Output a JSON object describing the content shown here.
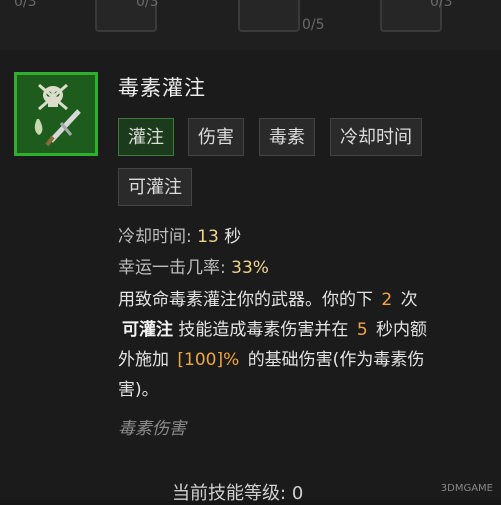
{
  "top_strip": {
    "counts": [
      "0/3",
      "0/3",
      "0/3",
      "0/5"
    ]
  },
  "skill": {
    "title": "毒素灌注",
    "icon": "poison-skull-dagger-icon",
    "tags": [
      "灌注",
      "伤害",
      "毒素",
      "冷却时间",
      "可灌注"
    ]
  },
  "stats": {
    "cooldown_label": "冷却时间:",
    "cooldown_value": "13",
    "cooldown_unit": "秒",
    "lucky_label": "幸运一击几率:",
    "lucky_value": "33%"
  },
  "description": {
    "l1_a": "用致命毒素灌注你的武器。你的下",
    "l1_num": "2",
    "l1_b": "次",
    "l2_key": "可灌注",
    "l2_a": "技能造成毒素伤害并在",
    "l2_num": "5",
    "l2_b": "秒内额",
    "l3_a": "外施加",
    "l3_num": "[100]%",
    "l3_b": "的基础伤害(作为毒素伤",
    "l4": "害)。"
  },
  "damage_type": "毒素伤害",
  "level": {
    "label": "当前技能等级:",
    "value": "0"
  },
  "watermark": "3DMGAME"
}
